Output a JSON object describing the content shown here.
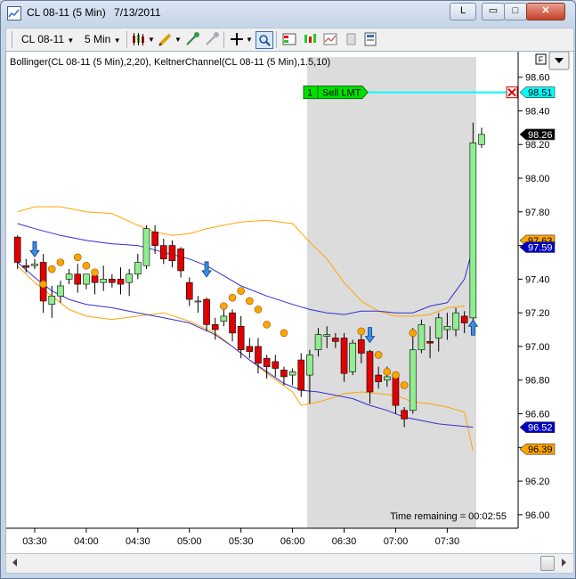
{
  "window": {
    "title": "CL 08-11 (5 Min)",
    "date": "7/13/2011",
    "buttons": {
      "link": "L",
      "minimize": "▭",
      "maximize": "□",
      "close": "✕"
    }
  },
  "toolbar": {
    "instrument": "CL 08-11",
    "interval": "5 Min"
  },
  "chart": {
    "indicator_label": "Bollinger(CL 08-11 (5 Min),2,20), KeltnerChannel(CL 08-11 (5 Min),1.5,10)",
    "order": {
      "qty": "1",
      "label": "Sell LMT",
      "price": "98.51"
    },
    "time_remaining": "Time remaining = 00:02:55",
    "f_button": "F",
    "price_tags": [
      {
        "value": "98.51",
        "color": "#00ffff",
        "text_color": "#000000"
      },
      {
        "value": "98.26",
        "color": "#000000",
        "text_color": "#ffffff"
      },
      {
        "value": "97.63",
        "color": "#ffa500",
        "text_color": "#000000"
      },
      {
        "value": "97.59",
        "color": "#0000c0",
        "text_color": "#ffffff"
      },
      {
        "value": "96.52",
        "color": "#0000c0",
        "text_color": "#ffffff"
      },
      {
        "value": "96.39",
        "color": "#ffa500",
        "text_color": "#000000"
      }
    ],
    "y_ticks": [
      "98.60",
      "98.40",
      "98.20",
      "98.00",
      "97.80",
      "97.60",
      "97.40",
      "97.20",
      "97.00",
      "96.80",
      "96.60",
      "96.40",
      "96.20",
      "96.00"
    ],
    "x_ticks": [
      "03:30",
      "04:00",
      "04:30",
      "05:00",
      "05:30",
      "06:00",
      "06:30",
      "07:00",
      "07:30"
    ],
    "colors": {
      "up": "#90ee90",
      "down": "#e00000",
      "bollinger": "#ffa500",
      "keltner": "#3030d0",
      "session": "#dcdcdc",
      "order_line": "#00ffff"
    }
  },
  "chart_data": {
    "type": "candlestick",
    "title": "",
    "ylim": [
      95.92,
      98.72
    ],
    "x_range": [
      "03:15",
      "07:50"
    ],
    "series": [
      {
        "name": "CL 08-11 (5 Min)",
        "candles": [
          {
            "t": "03:20",
            "o": 97.65,
            "h": 97.66,
            "l": 97.46,
            "c": 97.5
          },
          {
            "t": "03:25",
            "o": 97.48,
            "h": 97.52,
            "l": 97.44,
            "c": 97.47
          },
          {
            "t": "03:30",
            "o": 97.48,
            "h": 97.52,
            "l": 97.46,
            "c": 97.49
          },
          {
            "t": "03:35",
            "o": 97.5,
            "h": 97.55,
            "l": 97.2,
            "c": 97.27
          },
          {
            "t": "03:40",
            "o": 97.25,
            "h": 97.36,
            "l": 97.17,
            "c": 97.3
          },
          {
            "t": "03:45",
            "o": 97.3,
            "h": 97.39,
            "l": 97.26,
            "c": 97.36
          },
          {
            "t": "03:50",
            "o": 97.4,
            "h": 97.46,
            "l": 97.37,
            "c": 97.43
          },
          {
            "t": "03:55",
            "o": 97.43,
            "h": 97.49,
            "l": 97.32,
            "c": 97.37
          },
          {
            "t": "04:00",
            "o": 97.37,
            "h": 97.43,
            "l": 97.34,
            "c": 97.43
          },
          {
            "t": "04:05",
            "o": 97.42,
            "h": 97.46,
            "l": 97.31,
            "c": 97.38
          },
          {
            "t": "04:10",
            "o": 97.38,
            "h": 97.48,
            "l": 97.33,
            "c": 97.4
          },
          {
            "t": "04:15",
            "o": 97.4,
            "h": 97.43,
            "l": 97.35,
            "c": 97.38
          },
          {
            "t": "04:20",
            "o": 97.4,
            "h": 97.47,
            "l": 97.31,
            "c": 97.37
          },
          {
            "t": "04:25",
            "o": 97.38,
            "h": 97.46,
            "l": 97.3,
            "c": 97.43
          },
          {
            "t": "04:30",
            "o": 97.43,
            "h": 97.55,
            "l": 97.4,
            "c": 97.5
          },
          {
            "t": "04:35",
            "o": 97.48,
            "h": 97.72,
            "l": 97.46,
            "c": 97.7
          },
          {
            "t": "04:40",
            "o": 97.68,
            "h": 97.72,
            "l": 97.55,
            "c": 97.6
          },
          {
            "t": "04:45",
            "o": 97.6,
            "h": 97.64,
            "l": 97.49,
            "c": 97.52
          },
          {
            "t": "04:50",
            "o": 97.6,
            "h": 97.63,
            "l": 97.47,
            "c": 97.51
          },
          {
            "t": "04:55",
            "o": 97.58,
            "h": 97.59,
            "l": 97.41,
            "c": 97.45
          },
          {
            "t": "05:00",
            "o": 97.38,
            "h": 97.41,
            "l": 97.24,
            "c": 97.28
          },
          {
            "t": "05:05",
            "o": 97.27,
            "h": 97.3,
            "l": 97.2,
            "c": 97.27
          },
          {
            "t": "05:10",
            "o": 97.28,
            "h": 97.29,
            "l": 97.09,
            "c": 97.13
          },
          {
            "t": "05:15",
            "o": 97.13,
            "h": 97.17,
            "l": 97.04,
            "c": 97.1
          },
          {
            "t": "05:20",
            "o": 97.15,
            "h": 97.22,
            "l": 97.12,
            "c": 97.18
          },
          {
            "t": "05:25",
            "o": 97.2,
            "h": 97.22,
            "l": 97.03,
            "c": 97.08
          },
          {
            "t": "05:30",
            "o": 97.12,
            "h": 97.18,
            "l": 96.93,
            "c": 96.98
          },
          {
            "t": "05:35",
            "o": 97.0,
            "h": 97.05,
            "l": 96.93,
            "c": 96.97
          },
          {
            "t": "05:40",
            "o": 97.0,
            "h": 97.05,
            "l": 96.84,
            "c": 96.9
          },
          {
            "t": "05:45",
            "o": 96.93,
            "h": 96.95,
            "l": 96.81,
            "c": 96.88
          },
          {
            "t": "05:50",
            "o": 96.91,
            "h": 96.95,
            "l": 96.82,
            "c": 96.87
          },
          {
            "t": "05:55",
            "o": 96.86,
            "h": 96.88,
            "l": 96.77,
            "c": 96.82
          },
          {
            "t": "06:00",
            "o": 96.83,
            "h": 96.87,
            "l": 96.77,
            "c": 96.85
          },
          {
            "t": "06:05",
            "o": 96.92,
            "h": 96.96,
            "l": 96.7,
            "c": 96.74
          },
          {
            "t": "06:10",
            "o": 96.83,
            "h": 96.98,
            "l": 96.66,
            "c": 96.95
          },
          {
            "t": "06:15",
            "o": 96.98,
            "h": 97.11,
            "l": 96.94,
            "c": 97.07
          },
          {
            "t": "06:20",
            "o": 97.06,
            "h": 97.12,
            "l": 96.99,
            "c": 97.07
          },
          {
            "t": "06:25",
            "o": 97.05,
            "h": 97.08,
            "l": 96.99,
            "c": 97.03
          },
          {
            "t": "06:30",
            "o": 97.05,
            "h": 97.08,
            "l": 96.79,
            "c": 96.84
          },
          {
            "t": "06:35",
            "o": 96.85,
            "h": 97.04,
            "l": 96.83,
            "c": 97.02
          },
          {
            "t": "06:40",
            "o": 97.04,
            "h": 97.09,
            "l": 96.9,
            "c": 96.96
          },
          {
            "t": "06:45",
            "o": 96.97,
            "h": 96.98,
            "l": 96.66,
            "c": 96.73
          },
          {
            "t": "06:50",
            "o": 96.83,
            "h": 96.88,
            "l": 96.75,
            "c": 96.79
          },
          {
            "t": "06:55",
            "o": 96.8,
            "h": 96.88,
            "l": 96.76,
            "c": 96.82
          },
          {
            "t": "07:00",
            "o": 96.82,
            "h": 96.83,
            "l": 96.6,
            "c": 96.65
          },
          {
            "t": "07:05",
            "o": 96.62,
            "h": 96.64,
            "l": 96.52,
            "c": 96.57
          },
          {
            "t": "07:10",
            "o": 96.62,
            "h": 97.11,
            "l": 96.6,
            "c": 96.98
          },
          {
            "t": "07:15",
            "o": 96.98,
            "h": 97.16,
            "l": 96.96,
            "c": 97.13
          },
          {
            "t": "07:20",
            "o": 97.03,
            "h": 97.12,
            "l": 96.93,
            "c": 97.02
          },
          {
            "t": "07:25",
            "o": 97.05,
            "h": 97.2,
            "l": 96.97,
            "c": 97.17
          },
          {
            "t": "07:30",
            "o": 97.1,
            "h": 97.2,
            "l": 97.04,
            "c": 97.12
          },
          {
            "t": "07:35",
            "o": 97.1,
            "h": 97.23,
            "l": 97.06,
            "c": 97.2
          },
          {
            "t": "07:40",
            "o": 97.18,
            "h": 97.21,
            "l": 97.08,
            "c": 97.14
          },
          {
            "t": "07:45",
            "o": 97.17,
            "h": 98.33,
            "l": 97.15,
            "c": 98.21
          },
          {
            "t": "07:50",
            "o": 98.2,
            "h": 98.3,
            "l": 98.18,
            "c": 98.26
          }
        ]
      }
    ],
    "bollinger_upper": [
      [
        "03:20",
        97.8
      ],
      [
        "03:30",
        97.83
      ],
      [
        "03:45",
        97.83
      ],
      [
        "04:00",
        97.8
      ],
      [
        "04:15",
        97.79
      ],
      [
        "04:30",
        97.72
      ],
      [
        "04:40",
        97.68
      ],
      [
        "04:50",
        97.66
      ],
      [
        "05:00",
        97.67
      ],
      [
        "05:10",
        97.7
      ],
      [
        "05:20",
        97.72
      ],
      [
        "05:30",
        97.74
      ],
      [
        "05:45",
        97.75
      ],
      [
        "06:00",
        97.73
      ],
      [
        "06:10",
        97.62
      ],
      [
        "06:20",
        97.52
      ],
      [
        "06:30",
        97.38
      ],
      [
        "06:40",
        97.27
      ],
      [
        "06:50",
        97.21
      ],
      [
        "07:00",
        97.18
      ],
      [
        "07:10",
        97.18
      ],
      [
        "07:20",
        97.19
      ],
      [
        "07:30",
        97.23
      ],
      [
        "07:40",
        97.24
      ]
    ],
    "bollinger_lower": [
      [
        "03:20",
        97.48
      ],
      [
        "03:30",
        97.38
      ],
      [
        "03:40",
        97.3
      ],
      [
        "03:50",
        97.22
      ],
      [
        "04:00",
        97.18
      ],
      [
        "04:15",
        97.16
      ],
      [
        "04:30",
        97.18
      ],
      [
        "04:45",
        97.2
      ],
      [
        "05:00",
        97.15
      ],
      [
        "05:15",
        97.08
      ],
      [
        "05:30",
        96.96
      ],
      [
        "05:45",
        96.84
      ],
      [
        "06:00",
        96.73
      ],
      [
        "06:05",
        96.65
      ],
      [
        "06:15",
        96.67
      ],
      [
        "06:25",
        96.7
      ],
      [
        "06:30",
        96.72
      ],
      [
        "06:40",
        96.73
      ],
      [
        "06:50",
        96.72
      ],
      [
        "07:00",
        96.71
      ],
      [
        "07:10",
        96.67
      ],
      [
        "07:20",
        96.66
      ],
      [
        "07:30",
        96.64
      ],
      [
        "07:40",
        96.61
      ],
      [
        "07:45",
        96.38
      ]
    ],
    "keltner_upper": [
      [
        "03:20",
        97.73
      ],
      [
        "03:30",
        97.7
      ],
      [
        "03:45",
        97.66
      ],
      [
        "04:00",
        97.63
      ],
      [
        "04:15",
        97.61
      ],
      [
        "04:30",
        97.6
      ],
      [
        "04:45",
        97.56
      ],
      [
        "05:00",
        97.52
      ],
      [
        "05:10",
        97.48
      ],
      [
        "05:20",
        97.42
      ],
      [
        "05:30",
        97.36
      ],
      [
        "05:45",
        97.3
      ],
      [
        "06:00",
        97.25
      ],
      [
        "06:10",
        97.22
      ],
      [
        "06:20",
        97.2
      ],
      [
        "06:30",
        97.19
      ],
      [
        "06:40",
        97.21
      ],
      [
        "06:50",
        97.21
      ],
      [
        "07:00",
        97.2
      ],
      [
        "07:10",
        97.2
      ],
      [
        "07:20",
        97.24
      ],
      [
        "07:30",
        97.26
      ],
      [
        "07:40",
        97.4
      ],
      [
        "07:45",
        97.59
      ]
    ],
    "keltner_lower": [
      [
        "03:20",
        97.5
      ],
      [
        "03:30",
        97.41
      ],
      [
        "03:40",
        97.33
      ],
      [
        "03:50",
        97.28
      ],
      [
        "04:00",
        97.25
      ],
      [
        "04:15",
        97.23
      ],
      [
        "04:30",
        97.2
      ],
      [
        "04:45",
        97.17
      ],
      [
        "05:00",
        97.14
      ],
      [
        "05:15",
        97.07
      ],
      [
        "05:25",
        97.0
      ],
      [
        "05:35",
        96.92
      ],
      [
        "05:45",
        96.85
      ],
      [
        "05:55",
        96.78
      ],
      [
        "06:05",
        96.74
      ],
      [
        "06:15",
        96.73
      ],
      [
        "06:25",
        96.71
      ],
      [
        "06:35",
        96.69
      ],
      [
        "06:45",
        96.65
      ],
      [
        "06:55",
        96.62
      ],
      [
        "07:05",
        96.58
      ],
      [
        "07:15",
        96.56
      ],
      [
        "07:25",
        96.54
      ],
      [
        "07:35",
        96.53
      ],
      [
        "07:45",
        96.52
      ]
    ],
    "signals": {
      "buy_arrows": [
        [
          "03:30",
          97.57
        ],
        [
          "05:10",
          97.45
        ],
        [
          "06:45",
          97.06
        ],
        [
          "07:45",
          97.12
        ]
      ],
      "dots": [
        [
          "03:35",
          97.37
        ],
        [
          "03:40",
          97.46
        ],
        [
          "03:45",
          97.5
        ],
        [
          "03:55",
          97.53
        ],
        [
          "04:00",
          97.48
        ],
        [
          "04:05",
          97.44
        ],
        [
          "05:20",
          97.24
        ],
        [
          "05:25",
          97.29
        ],
        [
          "05:30",
          97.33
        ],
        [
          "05:35",
          97.27
        ],
        [
          "05:40",
          97.22
        ],
        [
          "05:45",
          97.13
        ],
        [
          "05:55",
          97.08
        ],
        [
          "06:40",
          97.09
        ],
        [
          "06:50",
          96.95
        ],
        [
          "06:55",
          96.85
        ],
        [
          "07:00",
          96.83
        ],
        [
          "07:05",
          96.77
        ],
        [
          "07:10",
          97.08
        ]
      ]
    }
  }
}
